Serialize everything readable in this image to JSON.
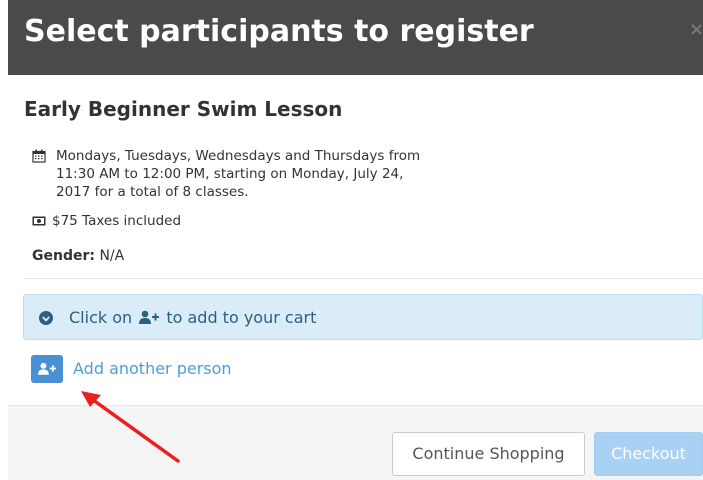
{
  "modal": {
    "title": "Select participants to register",
    "close_label": "×"
  },
  "lesson": {
    "title": "Early Beginner Swim Lesson",
    "schedule": "Mondays, Tuesdays, Wednesdays and Thursdays from 11:30 AM to 12:00 PM, starting on Monday, July 24, 2017 for a total of 8 classes.",
    "price": "$75 Taxes included",
    "gender_label": "Gender:",
    "gender_value": "N/A"
  },
  "info": {
    "prefix": "Click on",
    "suffix": "to add to your cart"
  },
  "add_person": {
    "label": "Add another person"
  },
  "footer": {
    "continue_label": "Continue Shopping",
    "checkout_label": "Checkout"
  },
  "colors": {
    "header_bg": "#4a4a4a",
    "info_bg": "#d9ecf8",
    "link": "#4a9fd8",
    "add_button": "#4a90d6",
    "checkout_bg": "#a9d1f3",
    "arrow": "#e8201f"
  },
  "icons": [
    "calendar-icon",
    "money-icon",
    "arrow-circle-down-icon",
    "user-plus-icon",
    "close-icon"
  ]
}
